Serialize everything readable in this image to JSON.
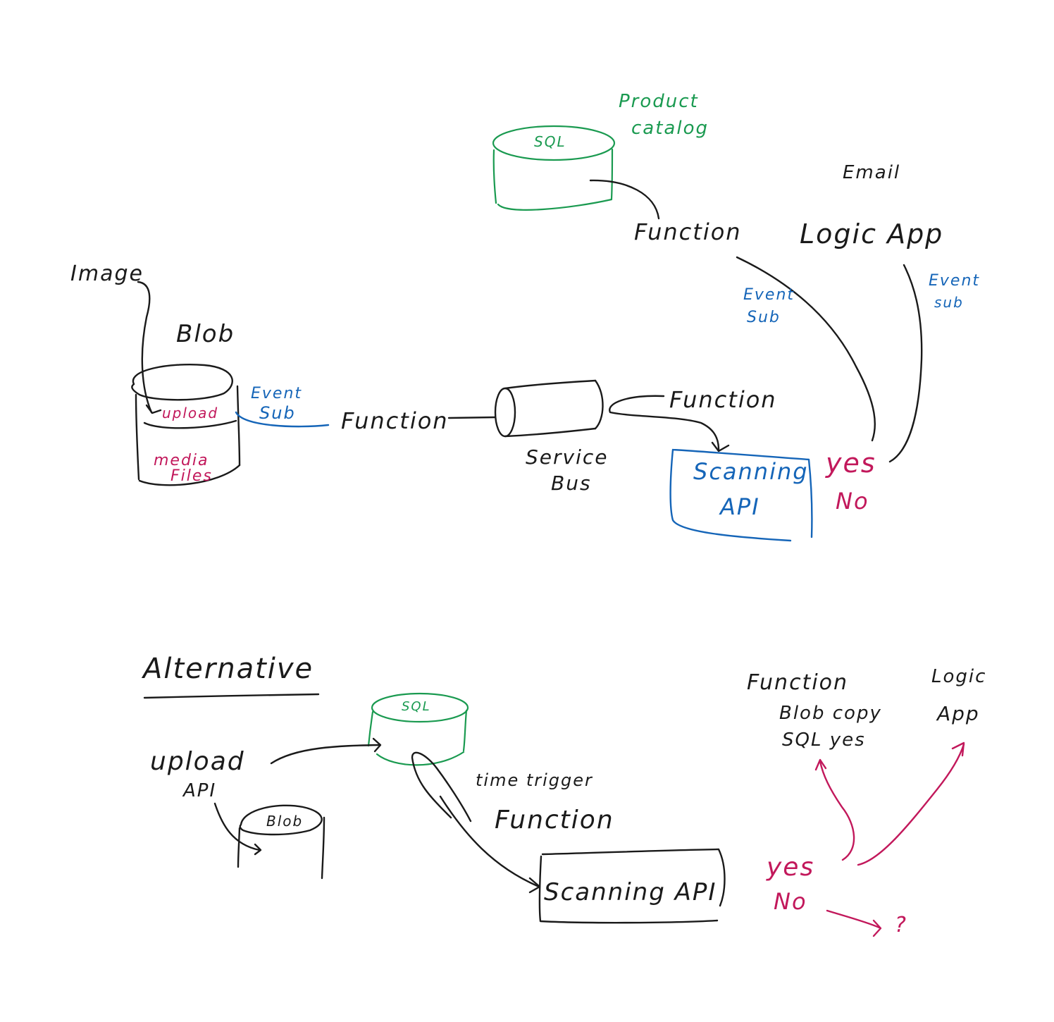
{
  "colors": {
    "ink": "#1a1a1a",
    "green": "#1a9a50",
    "blue": "#1565b8",
    "magenta": "#c2185b"
  },
  "top": {
    "product_catalog_1": "Product",
    "product_catalog_2": "catalog",
    "sql": "SQL",
    "email": "Email",
    "function_catalog": "Function",
    "logic_app": "Logic App",
    "event_sub_left_1": "Event",
    "event_sub_left_2": "Sub",
    "event_sub_right_1": "Event",
    "event_sub_right_2": "sub",
    "image": "Image",
    "blob": "Blob",
    "upload": "upload",
    "media_1": "media",
    "media_2": "Files",
    "event_sub_blob_1": "Event",
    "event_sub_blob_2": "Sub",
    "function_main": "Function",
    "service_bus_1": "Service",
    "service_bus_2": "Bus",
    "function_scan": "Function",
    "scanning_api_1": "Scanning",
    "scanning_api_2": "API",
    "yes": "yes",
    "no": "No"
  },
  "bottom": {
    "alternative": "Alternative",
    "sql": "SQL",
    "upload_api_1": "upload",
    "upload_api_2": "API",
    "blob": "Blob",
    "time_trigger": "time trigger",
    "function": "Function",
    "scanning_api": "Scanning API",
    "function_blob_1": "Function",
    "function_blob_2": "Blob copy",
    "function_blob_3": "SQL yes",
    "logic_app_1": "Logic",
    "logic_app_2": "App",
    "yes": "yes",
    "no": "No",
    "question": "?"
  }
}
